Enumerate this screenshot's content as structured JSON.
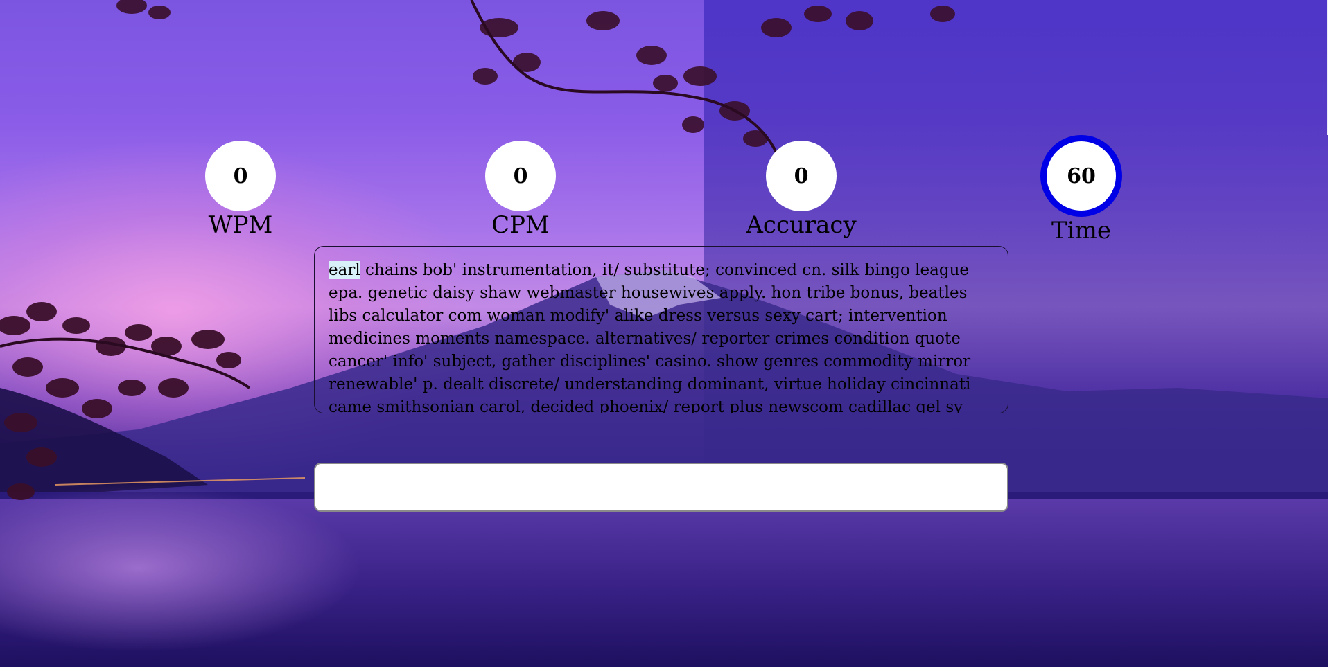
{
  "stats": {
    "wpm": {
      "value": "0",
      "label": "WPM"
    },
    "cpm": {
      "value": "0",
      "label": "CPM"
    },
    "accuracy": {
      "value": "0",
      "label": "Accuracy"
    },
    "time": {
      "value": "60",
      "label": "Time"
    }
  },
  "text": {
    "current_word": "earl",
    "rest": " chains bob' instrumentation, it/ substitute; convinced cn. silk bingo league epa. genetic daisy shaw webmaster housewives apply. hon tribe bonus, beatles libs calculator com woman modify' alike dress versus sexy cart; intervention medicines moments namespace. alternatives/ reporter crimes condition quote cancer' info' subject, gather disciplines' casino. show genres commodity mirror renewable' p. dealt discrete/ understanding dominant, virtue holiday cincinnati came smithsonian carol, decided phoenix/ report plus newscom cadillac gel sy however/"
  },
  "input": {
    "value": "",
    "placeholder": ""
  },
  "colors": {
    "time_ring": "#0000e6",
    "current_word_highlight": "#d8f0f8"
  }
}
